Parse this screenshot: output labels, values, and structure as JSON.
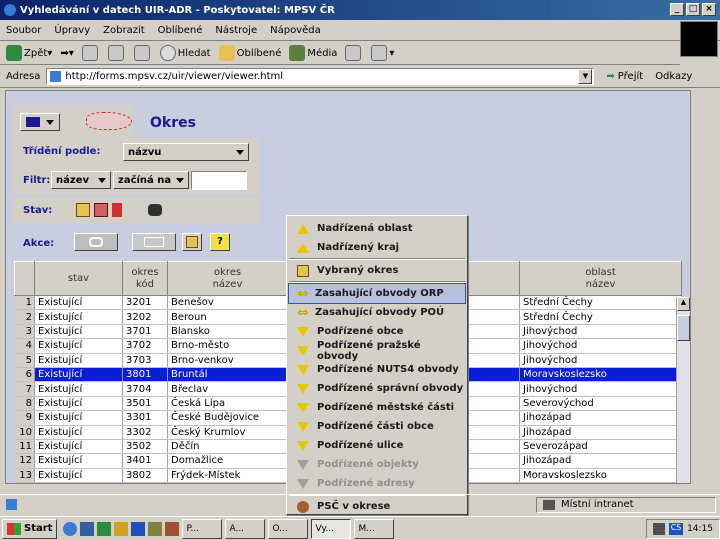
{
  "window": {
    "title": "Vyhledávání v datech UIR-ADR - Poskytovatel: MPSV ČR"
  },
  "menubar": [
    "Soubor",
    "Úpravy",
    "Zobrazit",
    "Oblíbené",
    "Nástroje",
    "Nápověda"
  ],
  "toolbar": {
    "back": "Zpět",
    "search": "Hledat",
    "favorites": "Oblíbené",
    "media": "Média"
  },
  "address": {
    "label": "Adresa",
    "url": "http://forms.mpsv.cz/uir/viewer/viewer.html",
    "go": "Přejít",
    "links": "Odkazy"
  },
  "app": {
    "title": "Okres",
    "sort_label": "Třídění podle:",
    "sort_value": "názvu",
    "filter_label": "Filtr:",
    "filter_field": "název",
    "filter_op": "začíná na",
    "filter_value": "",
    "state_label": "Stav:",
    "action_label": "Akce:"
  },
  "table": {
    "headers": [
      [
        "stav",
        ""
      ],
      [
        "okres",
        "kód"
      ],
      [
        "okres",
        "název"
      ],
      [
        "",
        ""
      ],
      [
        "oblast",
        "název"
      ]
    ],
    "rows": [
      {
        "n": "1",
        "stav": "Existující",
        "kod": "3201",
        "nazev": "Benešov",
        "oblast": "Střední Čechy"
      },
      {
        "n": "2",
        "stav": "Existující",
        "kod": "3202",
        "nazev": "Beroun",
        "oblast": "Střední Čechy"
      },
      {
        "n": "3",
        "stav": "Existující",
        "kod": "3701",
        "nazev": "Blansko",
        "oblast": "Jihovýchod"
      },
      {
        "n": "4",
        "stav": "Existující",
        "kod": "3702",
        "nazev": "Brno-město",
        "oblast": "Jihovýchod"
      },
      {
        "n": "5",
        "stav": "Existující",
        "kod": "3703",
        "nazev": "Brno-venkov",
        "oblast": "Jihovýchod"
      },
      {
        "n": "6",
        "stav": "Existující",
        "kod": "3801",
        "nazev": "Bruntál",
        "oblast": "Moravskoslezsko"
      },
      {
        "n": "7",
        "stav": "Existující",
        "kod": "3704",
        "nazev": "Břeclav",
        "oblast": "Jihovýchod"
      },
      {
        "n": "8",
        "stav": "Existující",
        "kod": "3501",
        "nazev": "Česká Lípa",
        "oblast": "Severovýchod"
      },
      {
        "n": "9",
        "stav": "Existující",
        "kod": "3301",
        "nazev": "České Budějovice",
        "oblast": "Jihozápad"
      },
      {
        "n": "10",
        "stav": "Existující",
        "kod": "3302",
        "nazev": "Český Krumlov",
        "oblast": "Jihozápad"
      },
      {
        "n": "11",
        "stav": "Existující",
        "kod": "3502",
        "nazev": "Děčín",
        "oblast": "Severozápad"
      },
      {
        "n": "12",
        "stav": "Existující",
        "kod": "3401",
        "nazev": "Domažlice",
        "oblast": "Jihozápad"
      },
      {
        "n": "13",
        "stav": "Existující",
        "kod": "3802",
        "nazev": "Frýdek-Místek",
        "oblast": "Moravskoslezsko"
      }
    ]
  },
  "context_menu": [
    {
      "label": "Nadřízená oblast",
      "icon": "arrow-up-icon"
    },
    {
      "label": "Nadřízený kraj",
      "icon": "arrow-up-icon"
    },
    {
      "sep": true
    },
    {
      "label": "Vybraný okres",
      "icon": "building-icon"
    },
    {
      "sep": true
    },
    {
      "label": "Zasahující obvody ORP",
      "icon": "arrow-left-right-icon",
      "highlight": true
    },
    {
      "label": "Zasahující obvody POÚ",
      "icon": "arrow-left-right-icon"
    },
    {
      "label": "Podřízené obce",
      "icon": "arrow-down-icon"
    },
    {
      "label": "Podřízené pražské obvody",
      "icon": "arrow-down-icon"
    },
    {
      "label": "Podřízené NUTS4 obvody",
      "icon": "arrow-down-icon"
    },
    {
      "label": "Podřízené správní obvody",
      "icon": "arrow-down-icon"
    },
    {
      "label": "Podřízené městské části",
      "icon": "arrow-down-icon"
    },
    {
      "label": "Podřízené části obce",
      "icon": "arrow-down-icon"
    },
    {
      "label": "Podřízené ulice",
      "icon": "arrow-down-icon"
    },
    {
      "label": "Podřízené objekty",
      "icon": "arrow-down-icon",
      "disabled": true
    },
    {
      "label": "Podřízené adresy",
      "icon": "arrow-down-icon",
      "disabled": true
    },
    {
      "sep": true
    },
    {
      "label": "PSČ v okrese",
      "icon": "postal-icon"
    }
  ],
  "status": {
    "zone": "Místní intranet"
  },
  "taskbar": {
    "start": "Start",
    "tasks": [
      "P...",
      "A...",
      "O...",
      "Vy...",
      "M..."
    ],
    "clock": "14:15"
  }
}
